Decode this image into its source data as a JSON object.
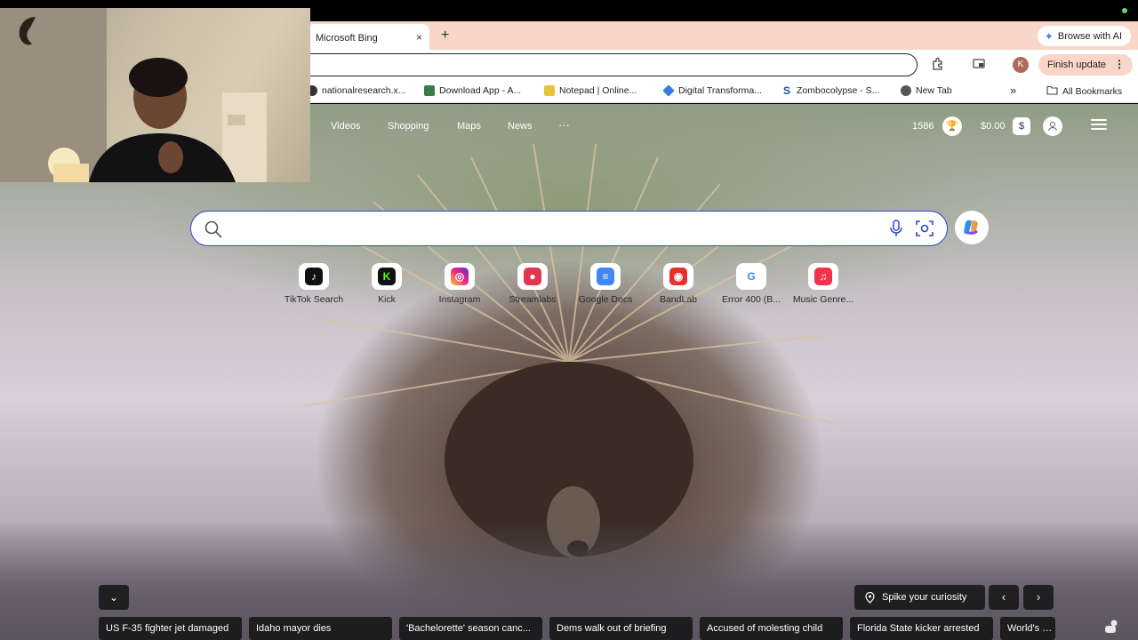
{
  "browser": {
    "tab_title": "Microsoft Bing",
    "tab_close": "×",
    "new_tab": "+",
    "browse_ai": "Browse with AI",
    "profile_initial": "K",
    "finish_update": "Finish update",
    "menu_dots": "⋮",
    "bookmarks": [
      {
        "label": "nationalresearch.x...",
        "icon": "globe-icon",
        "color": "#333333"
      },
      {
        "label": "Download App - A...",
        "icon": "app-icon",
        "color": "#3a7d44"
      },
      {
        "label": "Notepad | Online...",
        "icon": "notepad-icon",
        "color": "#e8c33b"
      },
      {
        "label": "Digital Transforma...",
        "icon": "diamond-icon",
        "color": "#3b7ddd"
      },
      {
        "label": "Zombocolypse - S...",
        "icon": "s-logo-icon",
        "color": "#1f4fa8"
      },
      {
        "label": "New Tab",
        "icon": "chrome-icon",
        "color": "#555555"
      }
    ],
    "more_bookmarks": "»",
    "all_bookmarks": "All Bookmarks"
  },
  "bing": {
    "nav": [
      "Videos",
      "Shopping",
      "Maps",
      "News",
      "···"
    ],
    "points": "1586",
    "balance": "$0.00",
    "balance_icon": "$",
    "search_placeholder": "",
    "quick_links": [
      {
        "label": "TikTok Search",
        "icon": "tiktok-icon",
        "color": "#111111",
        "glyph": "♪"
      },
      {
        "label": "Kick",
        "icon": "kick-icon",
        "color": "#111111",
        "glyph": "K"
      },
      {
        "label": "Instagram",
        "icon": "instagram-icon",
        "color": "#d6249f",
        "glyph": "◎"
      },
      {
        "label": "Streamlabs",
        "icon": "streamlabs-icon",
        "color": "#e0364f",
        "glyph": "●"
      },
      {
        "label": "Google Docs",
        "icon": "docs-icon",
        "color": "#4285f4",
        "glyph": "≡"
      },
      {
        "label": "BandLab",
        "icon": "bandlab-icon",
        "color": "#e4312b",
        "glyph": "◉"
      },
      {
        "label": "Error 400 (B...",
        "icon": "google-icon",
        "color": "#ffffff",
        "glyph": "G"
      },
      {
        "label": "Music Genre...",
        "icon": "music-icon",
        "color": "#f0324a",
        "glyph": "♫"
      }
    ],
    "spike": "Spike your curiosity",
    "prev": "‹",
    "next": "›",
    "collapse": "⌄",
    "headlines": [
      "US F-35 fighter jet damaged",
      "Idaho mayor dies",
      "'Bachelorette' season canc...",
      "Dems walk out of briefing",
      "Accused of molesting child",
      "Florida State kicker arrested",
      "World's hap"
    ]
  },
  "colors": {
    "accent": "#2c46d6",
    "tabstrip": "#f9d6c8"
  }
}
